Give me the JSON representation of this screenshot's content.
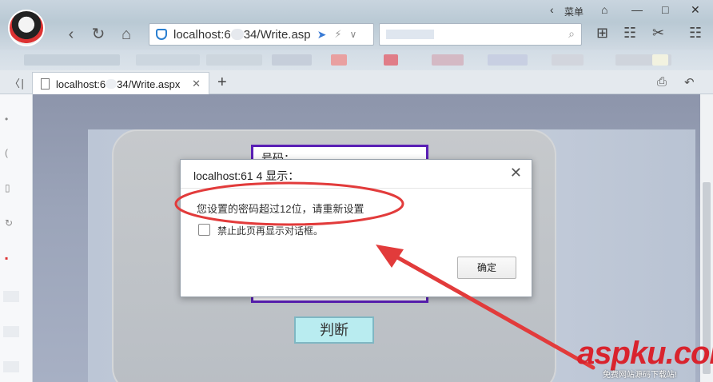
{
  "browser": {
    "menu_label": "菜单",
    "address": {
      "url_prefix": "localhost:6",
      "url_suffix": "34/Write.asp"
    },
    "tab": {
      "title_prefix": "localhost:6",
      "title_suffix": "34/Write.aspx"
    },
    "icons": {
      "back": "chevron-left-icon",
      "refresh": "refresh-icon",
      "home": "home-icon",
      "shield": "shield-icon",
      "rocket": "rocket-icon",
      "bolt": "bolt-icon",
      "search": "search-icon",
      "apps": "apps-icon",
      "reader": "reader-icon",
      "scissors": "scissors-icon",
      "more": "more-icon"
    }
  },
  "page": {
    "form_label": "号码：",
    "judge_button": "判断"
  },
  "dialog": {
    "title": "localhost:61  4 显示：",
    "message": "您设置的密码超过12位，请重新设置",
    "suppress_label": "禁止此页再显示对话框。",
    "ok_button": "确定"
  },
  "annotation": {
    "color": "#e23b3b"
  },
  "watermark": {
    "brand": "aspku.com",
    "tagline": "免费网站源码下载站!"
  }
}
